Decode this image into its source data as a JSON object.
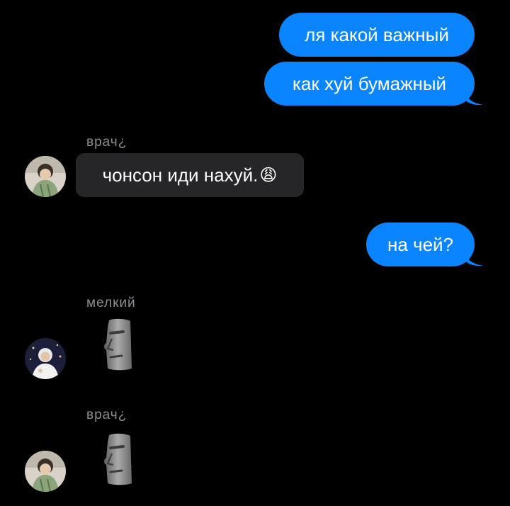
{
  "messages": {
    "m1": "ля какой важный",
    "m2": "как хуй бумажный",
    "m3_text": "чонсон иди нахуй.",
    "m3_emoji": "😩",
    "m4": "на чей?"
  },
  "senders": {
    "s1": "врач¿",
    "s2": "мелкий",
    "s3": "врач¿"
  },
  "colors": {
    "background": "#000000",
    "outgoing_bubble": "#0a84ff",
    "incoming_bubble": "#262628",
    "sender_label": "#8e8e93"
  },
  "icons": {
    "sticker": "moai-sticker-icon",
    "avatar": "user-avatar"
  }
}
